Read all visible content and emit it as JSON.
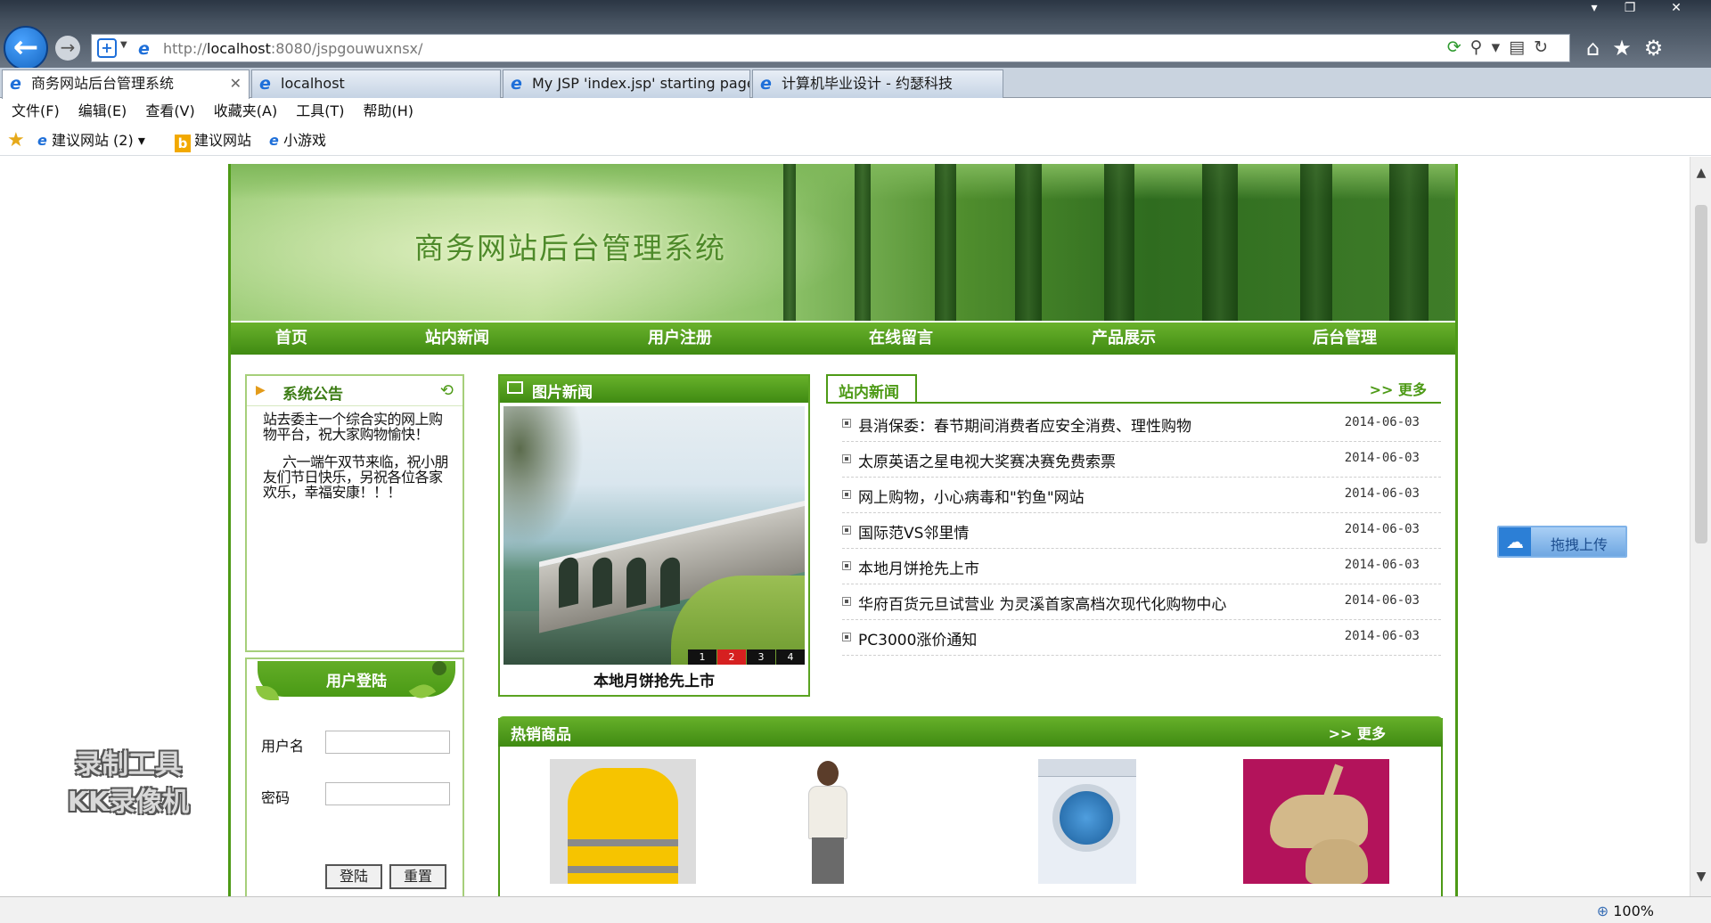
{
  "browser": {
    "window_controls": {
      "minimize": "▾",
      "restore": "❐",
      "close": "✕"
    },
    "address": {
      "host_prefix": "http://",
      "host": "localhost",
      "path": ":8080/jspgouwuxnsx/"
    },
    "tabs": [
      {
        "label": "商务网站后台管理系统",
        "active": true,
        "close": "✕"
      },
      {
        "label": "localhost"
      },
      {
        "label": "My JSP 'index.jsp' starting page"
      },
      {
        "label": "计算机毕业设计 - 约瑟科技"
      }
    ],
    "menu": [
      "文件(F)",
      "编辑(E)",
      "查看(V)",
      "收藏夹(A)",
      "工具(T)",
      "帮助(H)"
    ],
    "favorites": {
      "suggested": "建议网站 (2)",
      "bing_site": "建议网站",
      "games": "小游戏"
    },
    "status": {
      "zoom": "100%"
    }
  },
  "site": {
    "banner_title": "商务网站后台管理系统",
    "nav": [
      "首页",
      "站内新闻",
      "用户注册",
      "在线留言",
      "产品展示",
      "后台管理"
    ],
    "notice": {
      "title": "系统公告",
      "paragraphs": [
        "站去委主一个综合实的网上购物平台，祝大家购物愉快！",
        "六一端午双节来临，祝小朋友们节日快乐，另祝各位各家欢乐，幸福安康！！！"
      ]
    },
    "login": {
      "title": "用户登陆",
      "username_label": "用户名",
      "password_label": "密码",
      "login_button": "登陆",
      "reset_button": "重置"
    },
    "picture_news": {
      "title": "图片新闻",
      "caption": "本地月饼抢先上市",
      "pager": [
        "1",
        "2",
        "3",
        "4"
      ],
      "active_page": "2"
    },
    "site_news": {
      "title": "站内新闻",
      "more": "更多",
      "items": [
        {
          "title": "县消保委：春节期间消费者应安全消费、理性购物",
          "date": "2014-06-03"
        },
        {
          "title": "太原英语之星电视大奖赛决赛免费索票",
          "date": "2014-06-03"
        },
        {
          "title": "网上购物，小心病毒和\"钓鱼\"网站",
          "date": "2014-06-03"
        },
        {
          "title": "国际范VS邻里情",
          "date": "2014-06-03"
        },
        {
          "title": "本地月饼抢先上市",
          "date": "2014-06-03"
        },
        {
          "title": "华府百货元旦试营业 为灵溪首家高档次现代化购物中心",
          "date": "2014-06-03"
        },
        {
          "title": "PC3000涨价通知",
          "date": "2014-06-03"
        }
      ]
    },
    "hot_products": {
      "title": "热销商品",
      "more": "更多"
    }
  },
  "overlays": {
    "upload_label": "拖拽上传",
    "watermark_line1": "录制工具",
    "watermark_line2": "KK录像机"
  }
}
